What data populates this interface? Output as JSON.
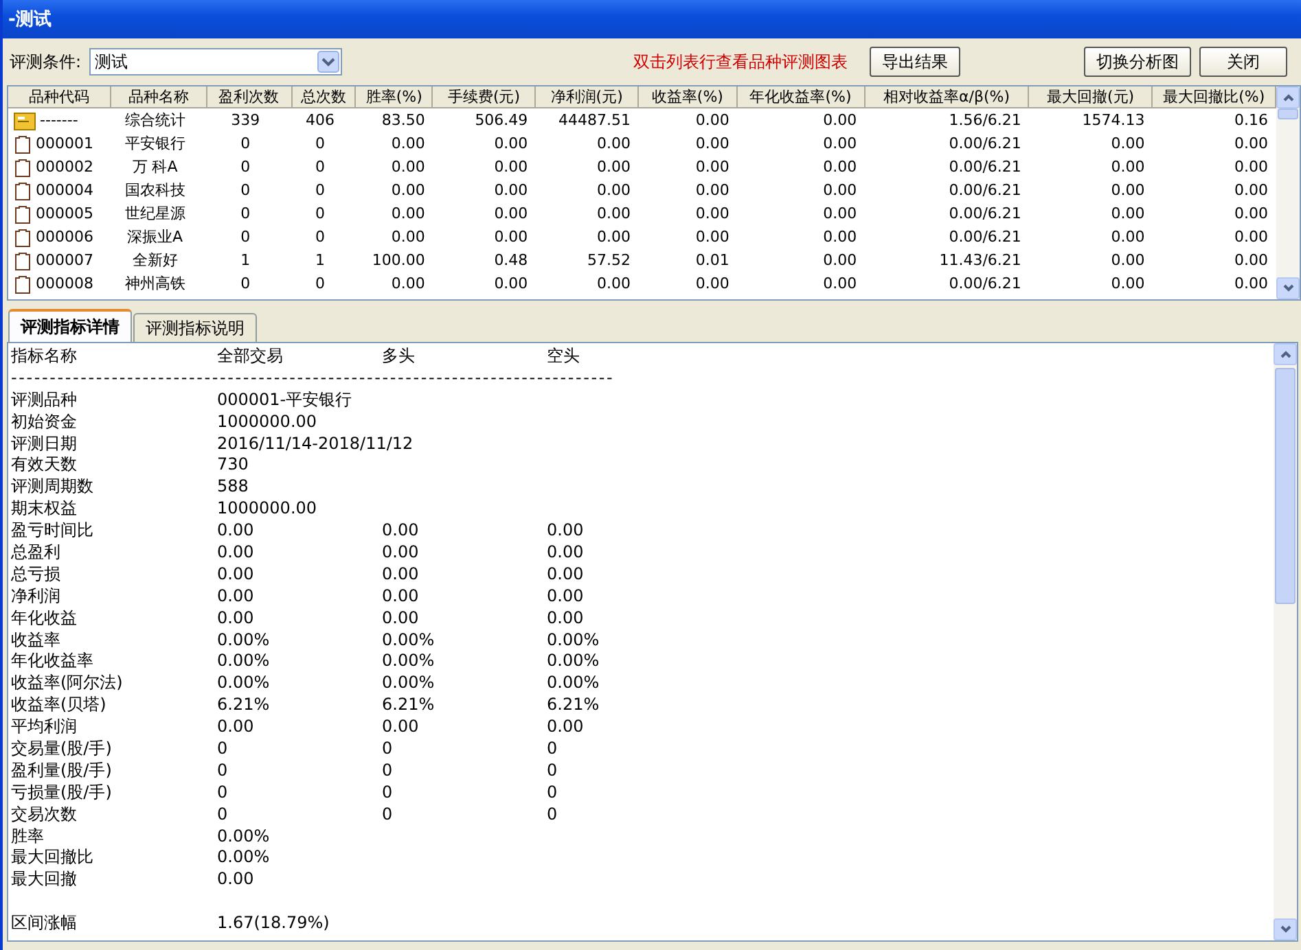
{
  "window": {
    "title": "-测试"
  },
  "toolbar": {
    "condition_label": "评测条件:",
    "condition_value": "测试",
    "hint": "双击列表行查看品种评测图表",
    "buttons": [
      "导出结果",
      "切换分析图",
      "关闭"
    ]
  },
  "table": {
    "columns": [
      "品种代码",
      "品种名称",
      "盈利次数",
      "总次数",
      "胜率(%)",
      "手续费(元)",
      "净利润(元)",
      "收益率(%)",
      "年化收益率(%)",
      "相对收益率α/β(%)",
      "最大回撤(元)",
      "最大回撤比(%)"
    ],
    "rows": [
      {
        "kind": "summary",
        "cells": [
          "-------",
          "综合统计",
          "339",
          "406",
          "83.50",
          "506.49",
          "44487.51",
          "0.00",
          "0.00",
          "1.56/6.21",
          "1574.13",
          "0.16"
        ]
      },
      {
        "kind": "stock",
        "cells": [
          "000001",
          "平安银行",
          "0",
          "0",
          "0.00",
          "0.00",
          "0.00",
          "0.00",
          "0.00",
          "0.00/6.21",
          "0.00",
          "0.00"
        ]
      },
      {
        "kind": "stock",
        "cells": [
          "000002",
          "万 科A",
          "0",
          "0",
          "0.00",
          "0.00",
          "0.00",
          "0.00",
          "0.00",
          "0.00/6.21",
          "0.00",
          "0.00"
        ]
      },
      {
        "kind": "stock",
        "cells": [
          "000004",
          "国农科技",
          "0",
          "0",
          "0.00",
          "0.00",
          "0.00",
          "0.00",
          "0.00",
          "0.00/6.21",
          "0.00",
          "0.00"
        ]
      },
      {
        "kind": "stock",
        "cells": [
          "000005",
          "世纪星源",
          "0",
          "0",
          "0.00",
          "0.00",
          "0.00",
          "0.00",
          "0.00",
          "0.00/6.21",
          "0.00",
          "0.00"
        ]
      },
      {
        "kind": "stock",
        "cells": [
          "000006",
          "深振业A",
          "0",
          "0",
          "0.00",
          "0.00",
          "0.00",
          "0.00",
          "0.00",
          "0.00/6.21",
          "0.00",
          "0.00"
        ]
      },
      {
        "kind": "stock",
        "cells": [
          "000007",
          "全新好",
          "1",
          "1",
          "100.00",
          "0.48",
          "57.52",
          "0.01",
          "0.00",
          "11.43/6.21",
          "0.00",
          "0.00"
        ]
      },
      {
        "kind": "stock",
        "cells": [
          "000008",
          "神州高铁",
          "0",
          "0",
          "0.00",
          "0.00",
          "0.00",
          "0.00",
          "0.00",
          "0.00/6.21",
          "0.00",
          "0.00"
        ]
      }
    ]
  },
  "tabs": [
    {
      "label": "评测指标详情",
      "selected": true
    },
    {
      "label": "评测指标说明",
      "selected": false
    }
  ],
  "details": [
    {
      "kind": "text",
      "cells": [
        "指标名称",
        "全部交易",
        "多头",
        "空头"
      ]
    },
    {
      "kind": "rule",
      "cells": [
        "------------------------------------------------------------------------------"
      ]
    },
    {
      "kind": "text",
      "cells": [
        "评测品种",
        "000001-平安银行"
      ]
    },
    {
      "kind": "text",
      "cells": [
        "初始资金",
        "1000000.00"
      ]
    },
    {
      "kind": "text",
      "cells": [
        "评测日期",
        "2016/11/14-2018/11/12"
      ]
    },
    {
      "kind": "text",
      "cells": [
        "有效天数",
        "730"
      ]
    },
    {
      "kind": "text",
      "cells": [
        "评测周期数",
        "588"
      ]
    },
    {
      "kind": "text",
      "cells": [
        "期末权益",
        "1000000.00"
      ]
    },
    {
      "kind": "text",
      "cells": [
        "盈亏时间比",
        "0.00",
        "0.00",
        "0.00"
      ]
    },
    {
      "kind": "text",
      "cells": [
        "总盈利",
        "0.00",
        "0.00",
        "0.00"
      ]
    },
    {
      "kind": "text",
      "cells": [
        "总亏损",
        "0.00",
        "0.00",
        "0.00"
      ]
    },
    {
      "kind": "text",
      "cells": [
        "净利润",
        "0.00",
        "0.00",
        "0.00"
      ]
    },
    {
      "kind": "text",
      "cells": [
        "年化收益",
        "0.00",
        "0.00",
        "0.00"
      ]
    },
    {
      "kind": "text",
      "cells": [
        "收益率",
        "0.00%",
        "0.00%",
        "0.00%"
      ]
    },
    {
      "kind": "text",
      "cells": [
        "年化收益率",
        "0.00%",
        "0.00%",
        "0.00%"
      ]
    },
    {
      "kind": "text",
      "cells": [
        "收益率(阿尔法)",
        "0.00%",
        "0.00%",
        "0.00%"
      ]
    },
    {
      "kind": "text",
      "cells": [
        "收益率(贝塔)",
        "6.21%",
        "6.21%",
        "6.21%"
      ]
    },
    {
      "kind": "text",
      "cells": [
        "平均利润",
        "0.00",
        "0.00",
        "0.00"
      ]
    },
    {
      "kind": "text",
      "cells": [
        "交易量(股/手)",
        "0",
        "0",
        "0"
      ]
    },
    {
      "kind": "text",
      "cells": [
        "盈利量(股/手)",
        "0",
        "0",
        "0"
      ]
    },
    {
      "kind": "text",
      "cells": [
        "亏损量(股/手)",
        "0",
        "0",
        "0"
      ]
    },
    {
      "kind": "text",
      "cells": [
        "交易次数",
        "0",
        "0",
        "0"
      ]
    },
    {
      "kind": "text",
      "cells": [
        "胜率",
        "0.00%"
      ]
    },
    {
      "kind": "text",
      "cells": [
        "最大回撤比",
        "0.00%"
      ]
    },
    {
      "kind": "text",
      "cells": [
        "最大回撤",
        "0.00"
      ]
    },
    {
      "kind": "blank"
    },
    {
      "kind": "text",
      "cells": [
        "区间涨幅",
        "1.67(18.79%)"
      ]
    }
  ]
}
